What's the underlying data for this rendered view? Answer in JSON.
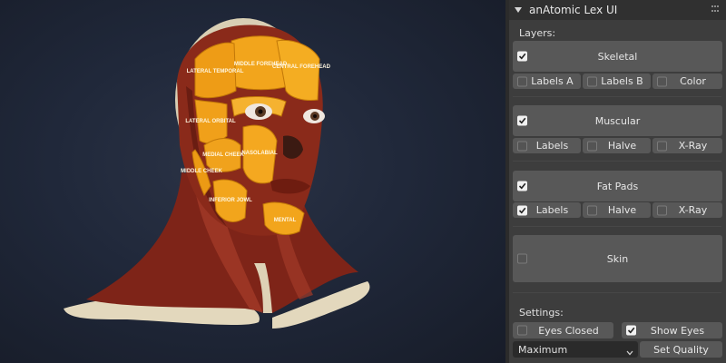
{
  "panel": {
    "title": "anAtomic Lex UI",
    "layers_label": "Layers:",
    "settings_label": "Settings:"
  },
  "layers": {
    "skeletal": {
      "label": "Skeletal",
      "checked": true,
      "options": [
        {
          "label": "Labels A",
          "checked": false
        },
        {
          "label": "Labels B",
          "checked": false
        },
        {
          "label": "Color",
          "checked": false
        }
      ]
    },
    "muscular": {
      "label": "Muscular",
      "checked": true,
      "options": [
        {
          "label": "Labels",
          "checked": false
        },
        {
          "label": "Halve",
          "checked": false
        },
        {
          "label": "X-Ray",
          "checked": false
        }
      ]
    },
    "fat_pads": {
      "label": "Fat Pads",
      "checked": true,
      "options": [
        {
          "label": "Labels",
          "checked": true
        },
        {
          "label": "Halve",
          "checked": false
        },
        {
          "label": "X-Ray",
          "checked": false
        }
      ]
    },
    "skin": {
      "label": "Skin",
      "checked": false
    }
  },
  "settings": {
    "eyes_closed": {
      "label": "Eyes Closed",
      "checked": false
    },
    "show_eyes": {
      "label": "Show Eyes",
      "checked": true
    },
    "quality_value": "Maximum",
    "set_quality_label": "Set Quality"
  },
  "viewport_labels": {
    "lateral_temporal": "LATERAL TEMPORAL",
    "middle_forehead": "MIDDLE FOREHEAD",
    "central_forehead": "CENTRAL FOREHEAD",
    "lateral_orbital": "LATERAL ORBITAL",
    "medial_cheek": "MEDIAL CHEEK",
    "nasolabial": "NASOLABIAL",
    "middle_cheek": "MIDDLE CHEEK",
    "inferior_jowl": "INFERIOR JOWL",
    "mental": "MENTAL"
  },
  "colors": {
    "panel_bg": "#3d3d3d",
    "button_bg": "#585858",
    "fat_pad": "#f2a51c",
    "muscle": "#8e2a1c",
    "bone": "#e6dcc4",
    "viewport_bg": "#20283a"
  }
}
